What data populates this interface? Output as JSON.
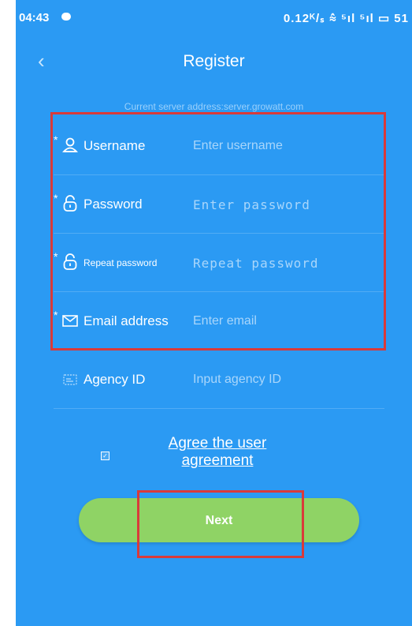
{
  "status": {
    "time": "04:43",
    "right": "0.12ᴷ/ₛ ⩯ ⁵ıl ⁵ıl ▭ 51"
  },
  "header": {
    "back_icon": "chevron-left-icon",
    "title": "Register"
  },
  "server_text": "Current server address:server.growatt.com",
  "form": {
    "required_mark": "*",
    "username": {
      "label": "Username",
      "placeholder": "Enter username",
      "icon": "user-icon"
    },
    "password": {
      "label": "Password",
      "placeholder": "Enter password",
      "icon": "lock-icon"
    },
    "repeat_password": {
      "label": "Repeat password",
      "placeholder": "Repeat password",
      "icon": "lock-icon"
    },
    "email": {
      "label": "Email address",
      "placeholder": "Enter email",
      "icon": "envelope-icon"
    },
    "agency": {
      "label": "Agency ID",
      "placeholder": "Input agency ID",
      "icon": "agency-icon"
    }
  },
  "agreement": {
    "checked": true,
    "link": "Agree the user agreement"
  },
  "next_button": "Next",
  "colors": {
    "background": "#2b9af3",
    "button": "#8fd365",
    "highlight": "#d93a3a"
  }
}
